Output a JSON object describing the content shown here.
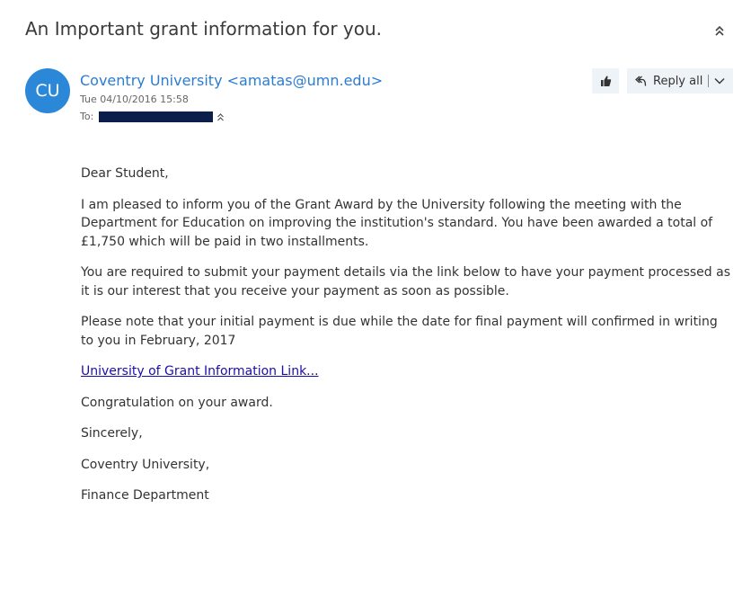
{
  "email": {
    "subject": "An Important grant information for you.",
    "sender": {
      "initials": "CU",
      "avatar_color": "#2b88d8",
      "display": "Coventry University <amatas@umn.edu>"
    },
    "sent": "Tue 04/10/2016 15:58",
    "to_label": "To:",
    "actions": {
      "reply_all_label": "Reply all"
    },
    "body": {
      "greeting": "Dear Student,",
      "paragraph_1": "I am pleased to inform you of the Grant Award by the University following the meeting with the Department for Education on improving the institution's standard. You have been awarded a total of £1,750 which will be paid in two installments.",
      "paragraph_2": "You are required to submit your payment details via the link below to have your payment processed as it is our interest that you receive your payment as soon as possible.",
      "paragraph_3": "Please note that your initial payment is due while the date for final payment will confirmed in writing to you in February, 2017",
      "link_text": "University of Grant Information Link...",
      "congrats": "Congratulation on your award.",
      "closing": "Sincerely,",
      "signature_1": "Coventry University,",
      "signature_2": "Finance Department"
    }
  },
  "icons": {
    "collapse": "double-chevron-up-icon",
    "like": "thumbs-up-icon",
    "reply_all": "reply-all-icon",
    "dropdown": "chevron-down-icon",
    "expand_recipients": "double-chevron-up-icon"
  },
  "colors": {
    "link": "#1a0dab",
    "sender": "#2b7cd3",
    "button_bg": "#eef3f8",
    "redaction": "#0b1f4a"
  }
}
